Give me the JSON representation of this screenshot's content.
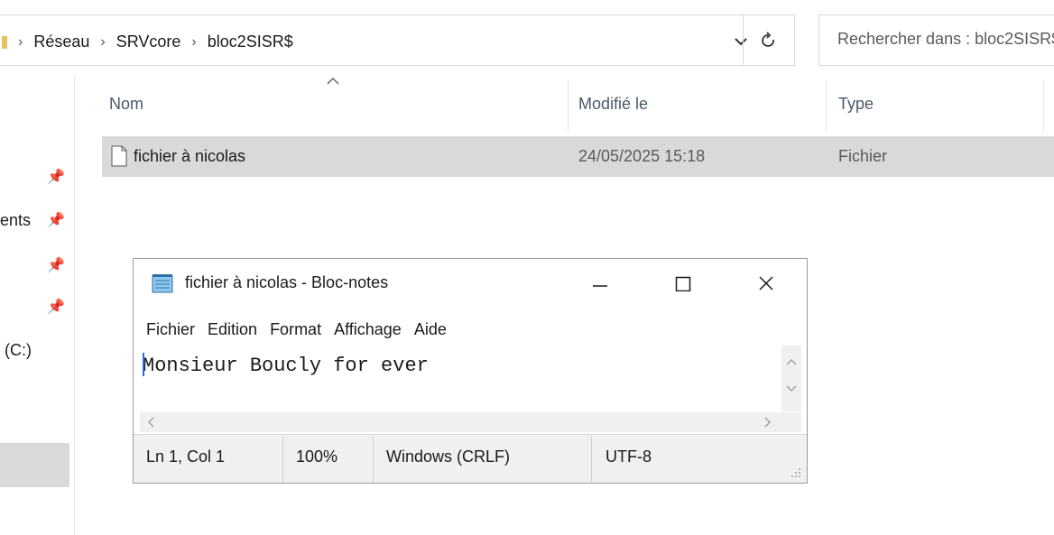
{
  "explorer": {
    "breadcrumb": [
      "Réseau",
      "SRVcore",
      "bloc2SISR$"
    ],
    "search_placeholder": "Rechercher dans : bloc2SISR$",
    "columns": {
      "name": "Nom",
      "modified": "Modifié le",
      "type": "Type"
    },
    "files": [
      {
        "name": "fichier à nicolas",
        "modified": "24/05/2025 15:18",
        "type": "Fichier"
      }
    ],
    "nav_items": {
      "documents_fragment": "ents",
      "drive_fragment": "(C:)"
    }
  },
  "notepad": {
    "title": "fichier à nicolas - Bloc-notes",
    "menu": [
      "Fichier",
      "Edition",
      "Format",
      "Affichage",
      "Aide"
    ],
    "content": "Monsieur Boucly for ever",
    "status": {
      "position": "Ln 1, Col 1",
      "zoom": "100%",
      "line_ending": "Windows (CRLF)",
      "encoding": "UTF-8"
    }
  },
  "colors": {
    "selection": "#d9d9d9",
    "border": "#d9d9d9",
    "caret": "#2a6ed6"
  }
}
